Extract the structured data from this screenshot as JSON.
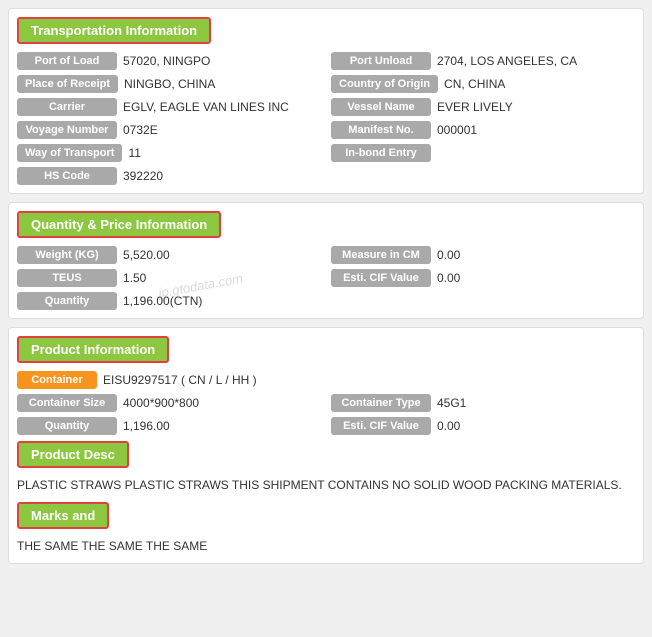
{
  "transportation": {
    "header": "Transportation Information",
    "fields_left": [
      {
        "label": "Port of Load",
        "value": "57020, NINGPO"
      },
      {
        "label": "Place of Receipt",
        "value": "NINGBO, CHINA"
      },
      {
        "label": "Carrier",
        "value": "EGLV, EAGLE VAN LINES INC"
      },
      {
        "label": "Voyage Number",
        "value": "0732E"
      },
      {
        "label": "Way of Transport",
        "value": "11"
      },
      {
        "label": "HS Code",
        "value": "392220"
      }
    ],
    "fields_right": [
      {
        "label": "Port Unload",
        "value": "2704, LOS ANGELES, CA"
      },
      {
        "label": "Country of Origin",
        "value": "CN, CHINA"
      },
      {
        "label": "Vessel Name",
        "value": "EVER LIVELY"
      },
      {
        "label": "Manifest No.",
        "value": "000001"
      },
      {
        "label": "In-bond Entry",
        "value": ""
      }
    ]
  },
  "quantity": {
    "header": "Quantity & Price Information",
    "fields_left": [
      {
        "label": "Weight (KG)",
        "value": "5,520.00"
      },
      {
        "label": "TEUS",
        "value": "1.50"
      },
      {
        "label": "Quantity",
        "value": "1,196.00(CTN)"
      }
    ],
    "fields_right": [
      {
        "label": "Measure in CM",
        "value": "0.00"
      },
      {
        "label": "Esti. CIF Value",
        "value": "0.00"
      }
    ]
  },
  "product": {
    "header": "Product Information",
    "container_label": "Container",
    "container_value": "EISU9297517 ( CN / L / HH )",
    "fields_left": [
      {
        "label": "Container Size",
        "value": "4000*900*800"
      },
      {
        "label": "Quantity",
        "value": "1,196.00"
      }
    ],
    "fields_right": [
      {
        "label": "Container Type",
        "value": "45G1"
      },
      {
        "label": "Esti. CIF Value",
        "value": "0.00"
      }
    ],
    "product_desc_header": "Product Desc",
    "product_desc_text": "PLASTIC STRAWS PLASTIC STRAWS THIS SHIPMENT CONTAINS NO SOLID WOOD PACKING MATERIALS.",
    "marks_header": "Marks and",
    "marks_text": "THE SAME THE SAME THE SAME"
  },
  "watermark": "jp.gtodata.com"
}
